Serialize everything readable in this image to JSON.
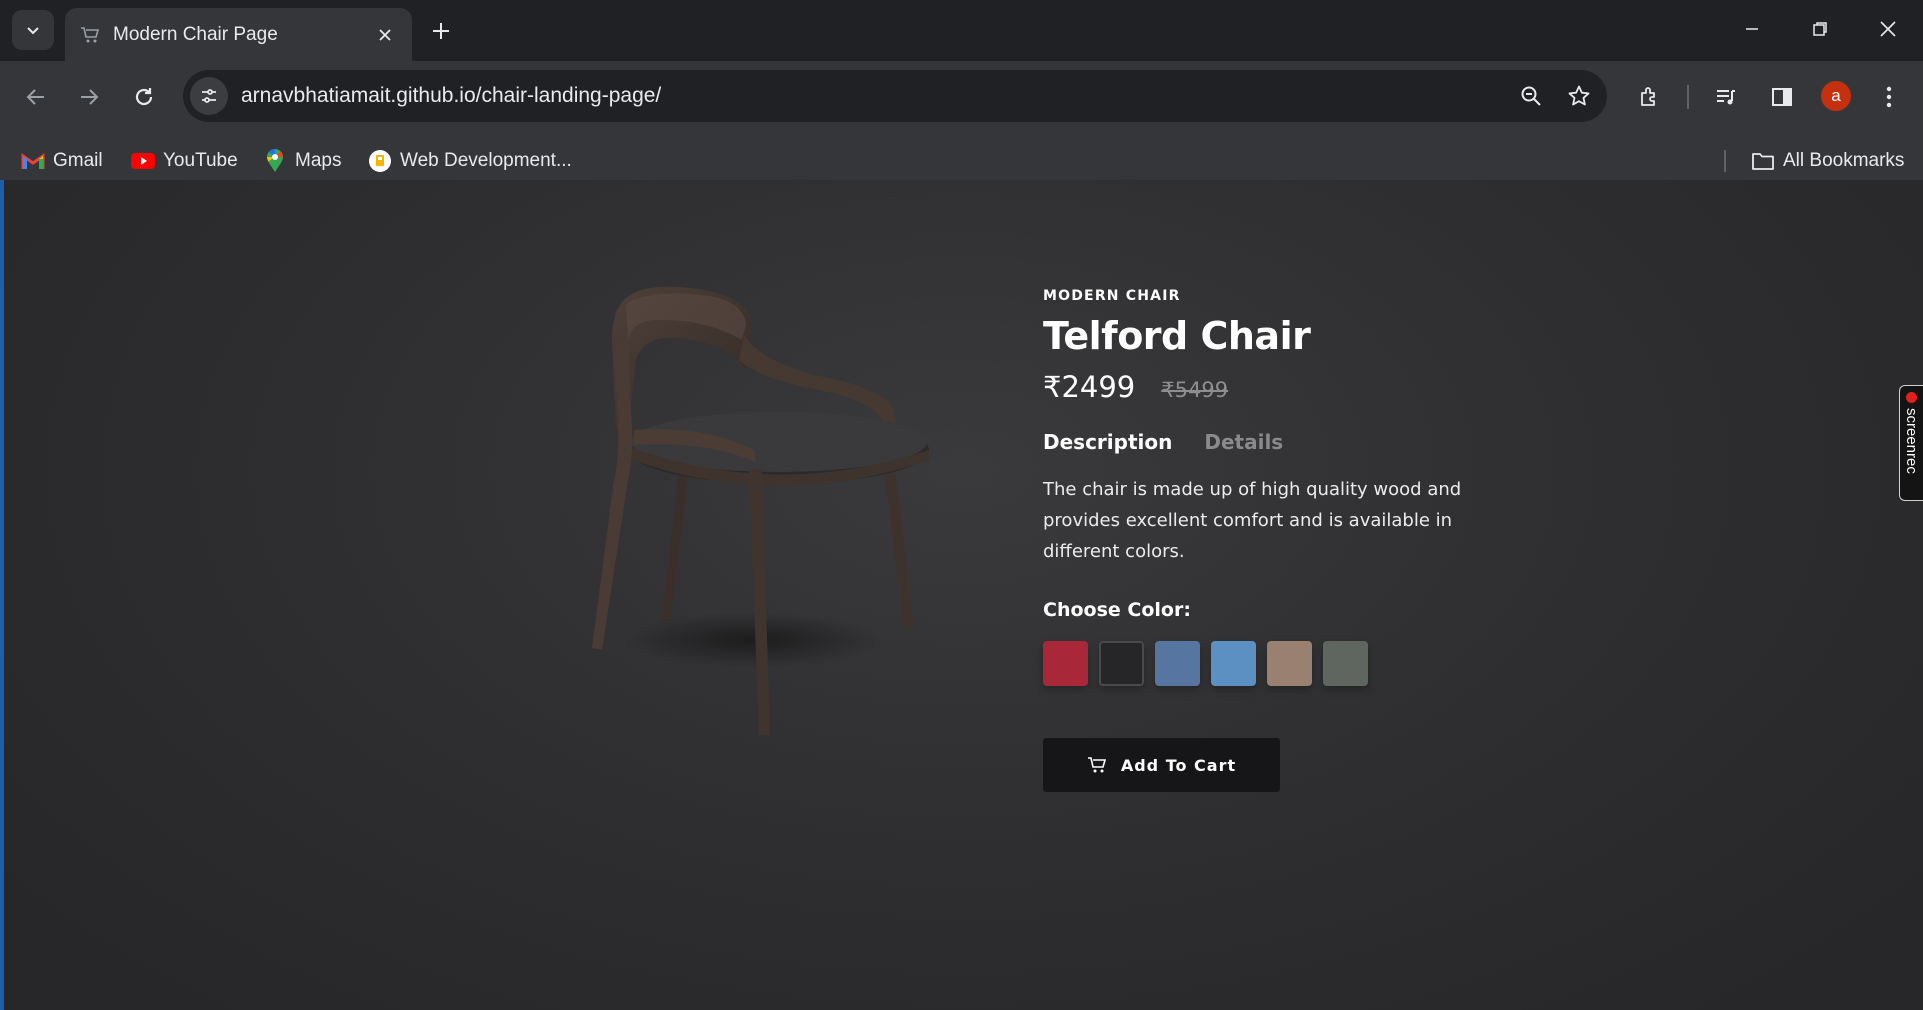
{
  "browser": {
    "tab": {
      "title": "Modern Chair Page"
    },
    "url": "arnavbhatiamait.github.io/chair-landing-page/",
    "profile_initial": "a",
    "bookmarks": [
      {
        "label": "Gmail",
        "icon": "gmail-icon"
      },
      {
        "label": "YouTube",
        "icon": "youtube-icon"
      },
      {
        "label": "Maps",
        "icon": "maps-icon"
      },
      {
        "label": "Web Development...",
        "icon": "web-dev-icon"
      }
    ],
    "all_bookmarks": "All Bookmarks"
  },
  "product": {
    "category": "MODERN CHAIR",
    "name": "Telford Chair",
    "price": "₹2499",
    "old_price": "₹5499",
    "tabs": [
      {
        "label": "Description",
        "active": true
      },
      {
        "label": "Details",
        "active": false
      }
    ],
    "description": "The chair is made up of high quality wood and provides excellent comfort and is available in different colors.",
    "color_label": "Choose Color:",
    "colors": [
      {
        "name": "red",
        "hex": "#a8283a"
      },
      {
        "name": "black",
        "hex": "#262628"
      },
      {
        "name": "denim",
        "hex": "#5675a0"
      },
      {
        "name": "sky-blue",
        "hex": "#5c8fc2"
      },
      {
        "name": "beige",
        "hex": "#9a8070"
      },
      {
        "name": "olive-grey",
        "hex": "#5f6660"
      }
    ],
    "selected_color": 1,
    "cart_label": "Add To Cart"
  },
  "overlay": {
    "screenrec_label": "screenrec"
  },
  "colors": {
    "browser_bg": "#202124",
    "toolbar_bg": "#35363a",
    "accent_avatar": "#c5310e"
  }
}
